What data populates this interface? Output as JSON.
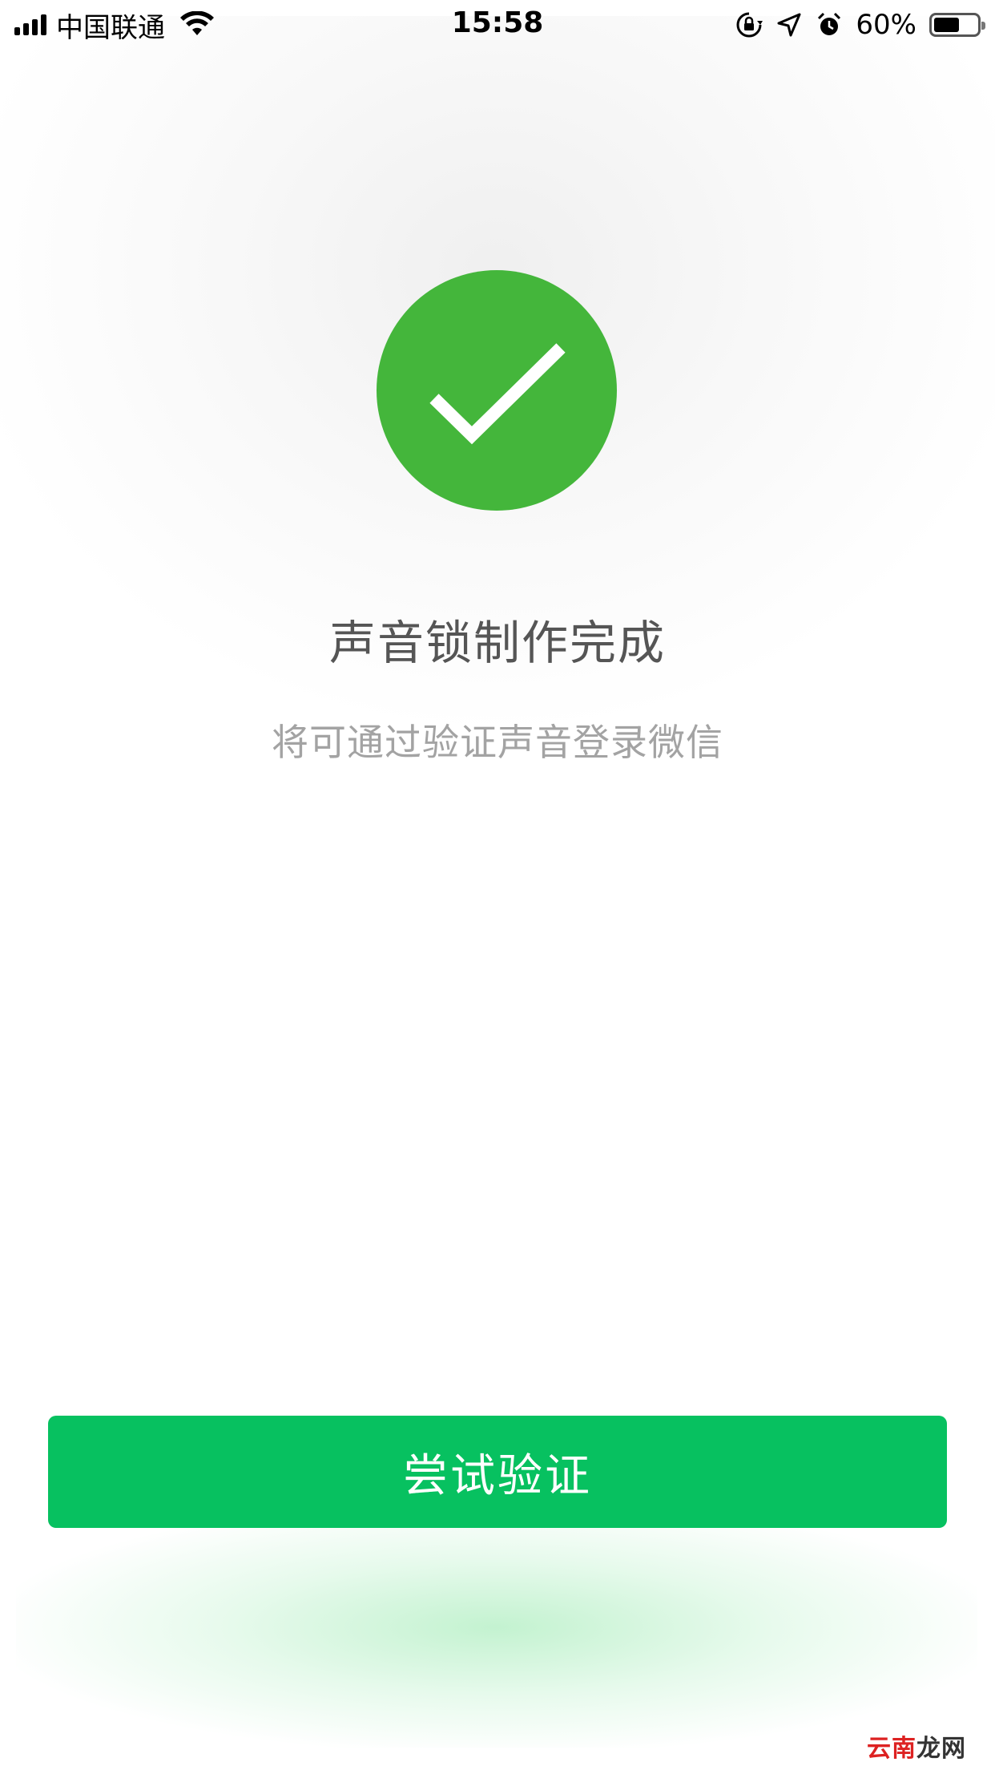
{
  "status_bar": {
    "carrier": "中国联通",
    "time": "15:58",
    "battery_percent_label": "60%",
    "battery_level": 0.6,
    "icons": [
      "signal-icon",
      "wifi-icon",
      "rotation-lock-icon",
      "location-icon",
      "alarm-icon",
      "battery-icon"
    ]
  },
  "result": {
    "icon": "checkmark-icon",
    "title": "声音锁制作完成",
    "subtitle": "将可通过验证声音登录微信"
  },
  "actions": {
    "verify_label": "尝试验证"
  },
  "watermark": {
    "part1": "云南",
    "part2": "龙网"
  },
  "colors": {
    "success_green": "#44b63b",
    "button_green": "#07c160",
    "title_text": "#555555",
    "subtitle_text": "#a3a3a3"
  }
}
